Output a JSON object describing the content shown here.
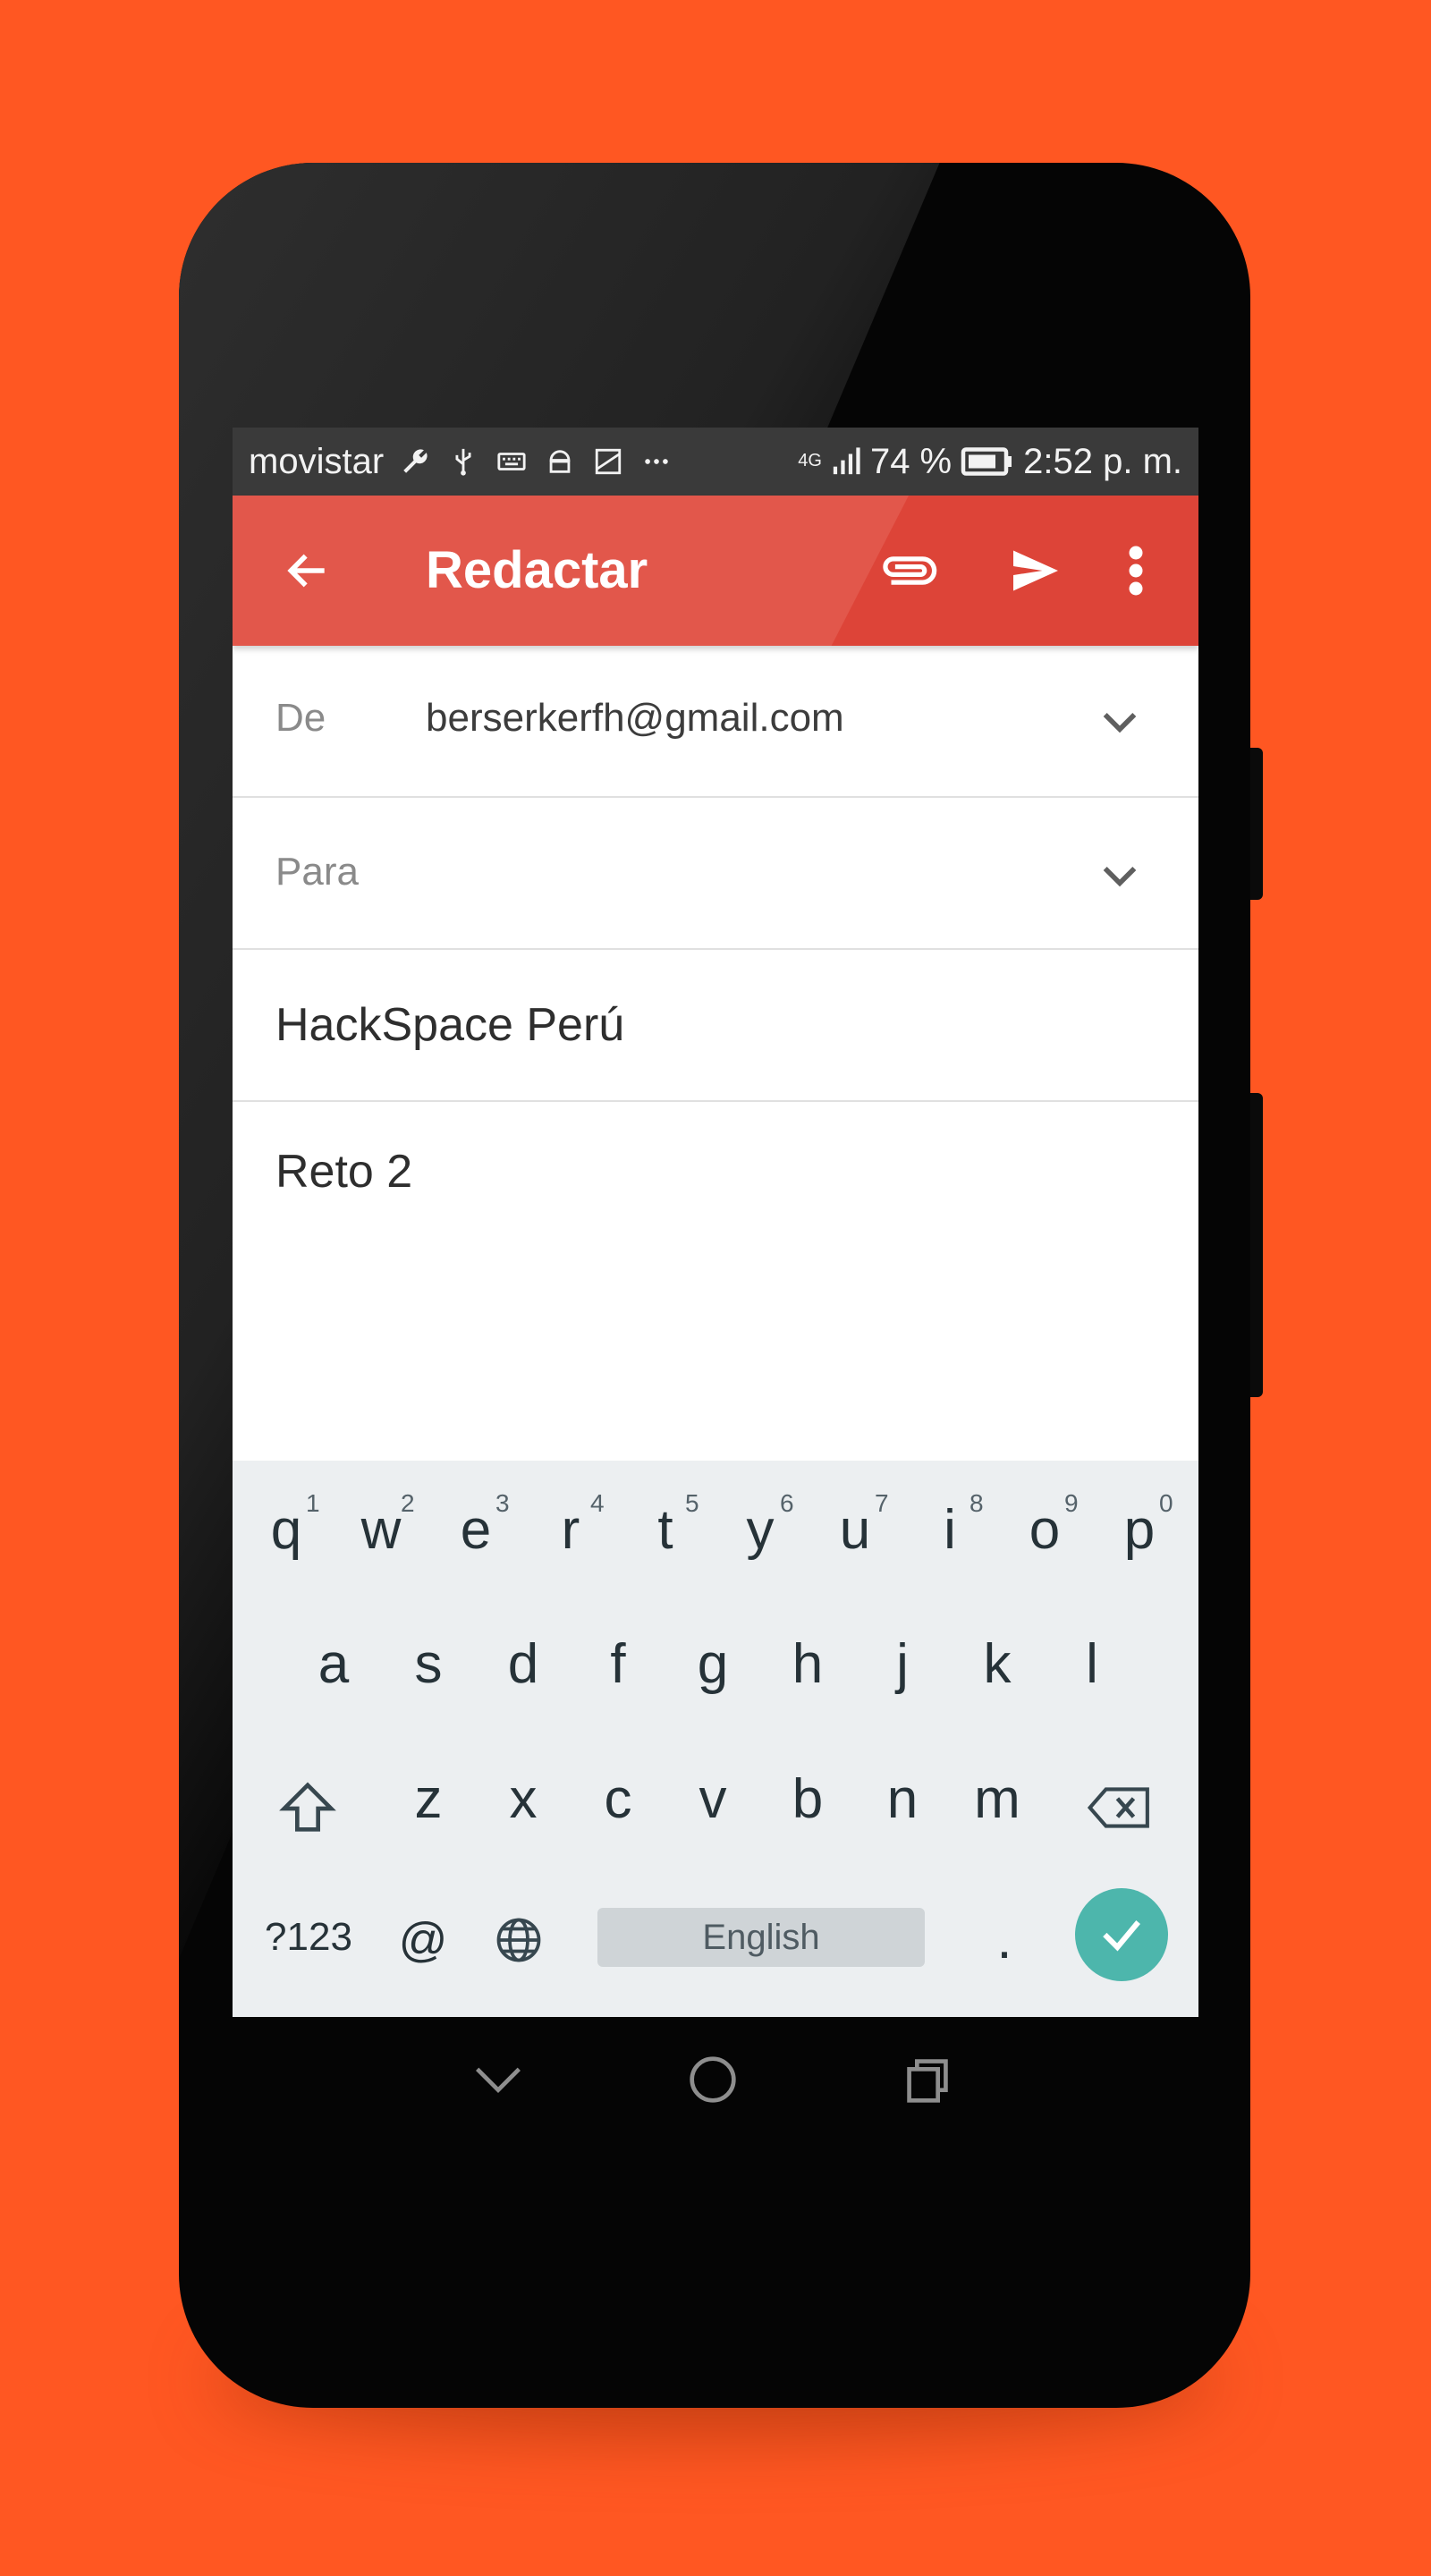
{
  "status_bar": {
    "carrier": "movistar",
    "icons": [
      "wrench-icon",
      "usb-icon",
      "keyboard-icon",
      "android-icon",
      "image-icon",
      "more-dots-icon"
    ],
    "network": "4G",
    "battery": "74 %",
    "time": "2:52 p. m."
  },
  "toolbar": {
    "title": "Redactar",
    "icons": [
      "back-arrow-icon",
      "attach-icon",
      "send-icon",
      "overflow-menu-icon"
    ]
  },
  "compose": {
    "from_label": "De",
    "from_value": "berserkerfh@gmail.com",
    "to_label": "Para",
    "subject": "HackSpace Perú",
    "body": "Reto 2"
  },
  "keyboard": {
    "row1": [
      "q",
      "w",
      "e",
      "r",
      "t",
      "y",
      "u",
      "i",
      "o",
      "p"
    ],
    "row1_hints": [
      "1",
      "2",
      "3",
      "4",
      "5",
      "6",
      "7",
      "8",
      "9",
      "0"
    ],
    "row2": [
      "a",
      "s",
      "d",
      "f",
      "g",
      "h",
      "j",
      "k",
      "l"
    ],
    "row3": [
      "z",
      "x",
      "c",
      "v",
      "b",
      "n",
      "m"
    ],
    "symbols_key": "?123",
    "at_key": "@",
    "space_label": "English",
    "period_key": "."
  },
  "colors": {
    "background": "#ff5722",
    "toolbar": "#e2574b",
    "keyboard": "#eceff1",
    "enter_key": "#4db6ac"
  }
}
